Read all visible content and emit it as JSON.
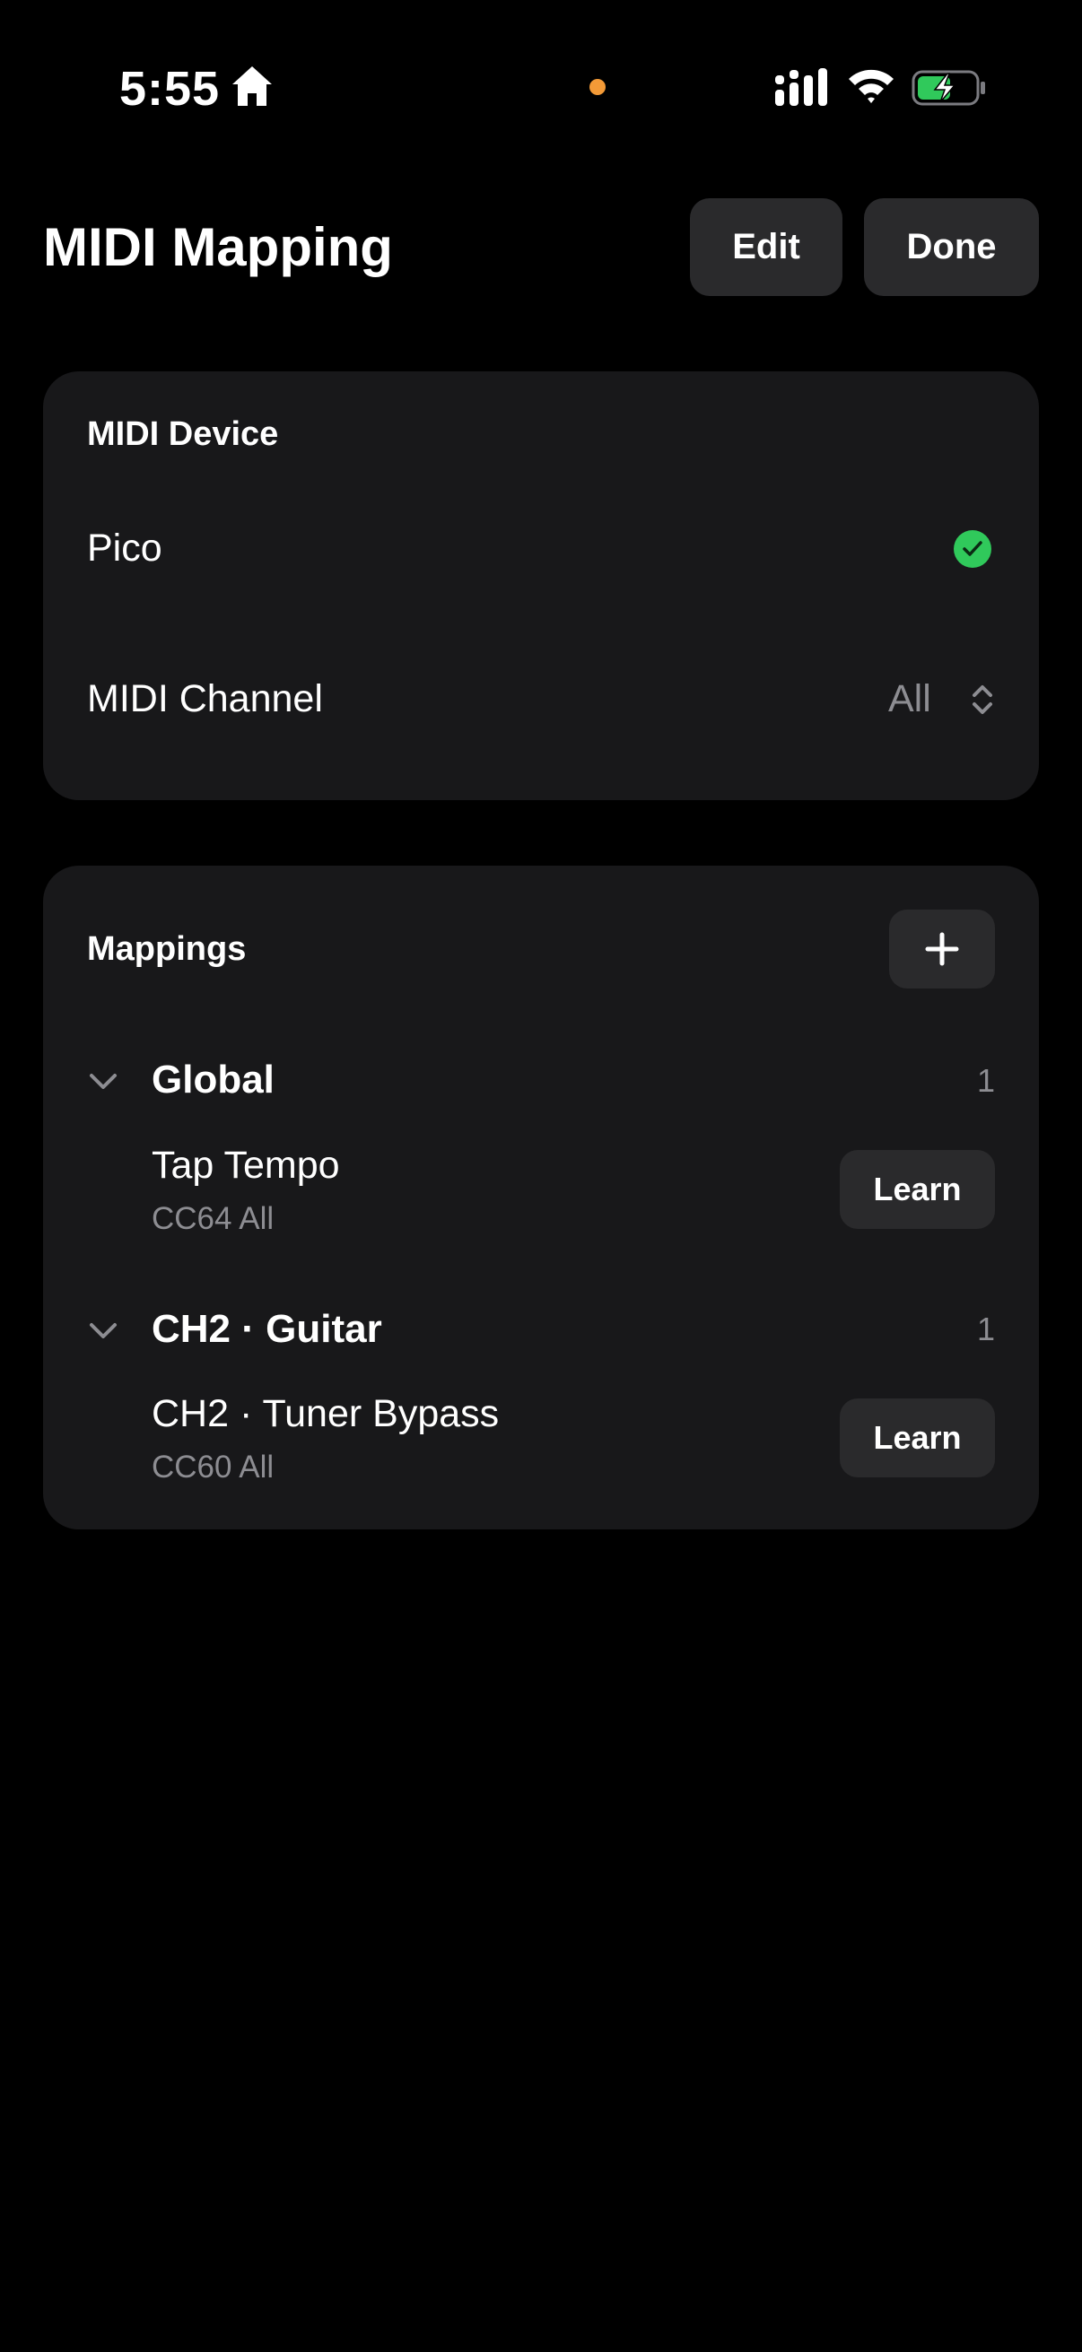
{
  "status_bar": {
    "time": "5:55",
    "icons": [
      "home-icon",
      "recording-dot-icon",
      "cellular-signal-icon",
      "wifi-icon",
      "battery-charging-icon"
    ]
  },
  "header": {
    "title": "MIDI Mapping",
    "edit_label": "Edit",
    "done_label": "Done"
  },
  "device_section": {
    "title": "MIDI Device",
    "device_name": "Pico",
    "channel_label": "MIDI Channel",
    "channel_value": "All"
  },
  "mappings_section": {
    "title": "Mappings",
    "groups": [
      {
        "name": "Global",
        "count": "1",
        "items": [
          {
            "title": "Tap Tempo",
            "subtitle": "CC64 All",
            "action": "Learn"
          }
        ]
      },
      {
        "name": "CH2 · Guitar",
        "count": "1",
        "items": [
          {
            "title": "CH2 · Tuner Bypass",
            "subtitle": "CC60 All",
            "action": "Learn"
          }
        ]
      }
    ]
  },
  "colors": {
    "background": "#000000",
    "card": "#18181a",
    "button": "#2a2a2c",
    "secondary_text": "#8d8d92",
    "success": "#30c95b",
    "indicator": "#f39a37"
  }
}
